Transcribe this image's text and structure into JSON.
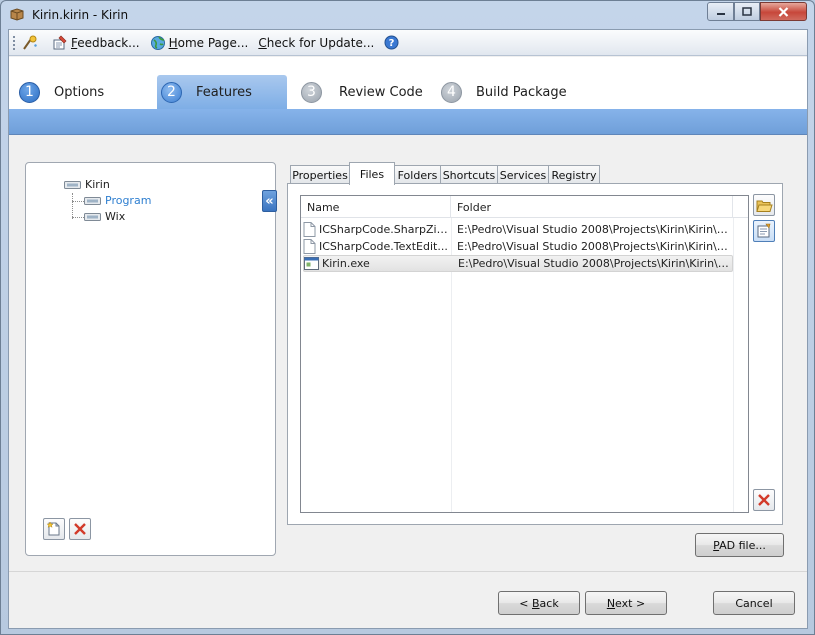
{
  "window": {
    "title": "Kirin.kirin - Kirin",
    "controls": {
      "minimize": "minimize-icon",
      "maximize": "maximize-icon",
      "close": "close-icon"
    }
  },
  "toolbar": {
    "items": [
      {
        "icon": "wizard-icon",
        "label": ""
      },
      {
        "icon": "feedback-icon",
        "label": "Feedback..."
      },
      {
        "icon": "globe-icon",
        "label": "Home Page..."
      },
      {
        "icon": "",
        "label": "Check for Update..."
      },
      {
        "icon": "help-icon",
        "label": ""
      }
    ]
  },
  "wizard": {
    "steps": [
      {
        "number": "1",
        "label": "Options"
      },
      {
        "number": "2",
        "label": "Features"
      },
      {
        "number": "3",
        "label": "Review Code"
      },
      {
        "number": "4",
        "label": "Build Package"
      }
    ],
    "active_step": "Features"
  },
  "tree": {
    "root": "Kirin",
    "children": [
      "Program",
      "Wix"
    ],
    "selected": "Program"
  },
  "tabs": [
    "Properties",
    "Files",
    "Folders",
    "Shortcuts",
    "Services",
    "Registry"
  ],
  "active_tab": "Files",
  "files": {
    "columns": [
      "Name",
      "Folder"
    ],
    "rows": [
      {
        "name": "ICSharpCode.SharpZip...",
        "folder": "E:\\Pedro\\Visual Studio 2008\\Projects\\Kirin\\Kirin\\bin\\R...",
        "icon": "document-icon"
      },
      {
        "name": "ICSharpCode.TextEdit...",
        "folder": "E:\\Pedro\\Visual Studio 2008\\Projects\\Kirin\\Kirin\\bin\\R...",
        "icon": "document-icon"
      },
      {
        "name": "Kirin.exe",
        "folder": "E:\\Pedro\\Visual Studio 2008\\Projects\\Kirin\\Kirin\\bin\\R...",
        "icon": "exe-icon"
      }
    ],
    "selected_row": "Kirin.exe"
  },
  "buttons": {
    "collapse": "«",
    "pad_file": "PAD file...",
    "back": "< Back",
    "next": "Next >",
    "cancel": "Cancel"
  },
  "colors": {
    "accent": "#3d7fd2",
    "selection_text": "#2f7fd0",
    "wizard_band": "#7eaee6",
    "delete_red": "#d23a2a"
  }
}
